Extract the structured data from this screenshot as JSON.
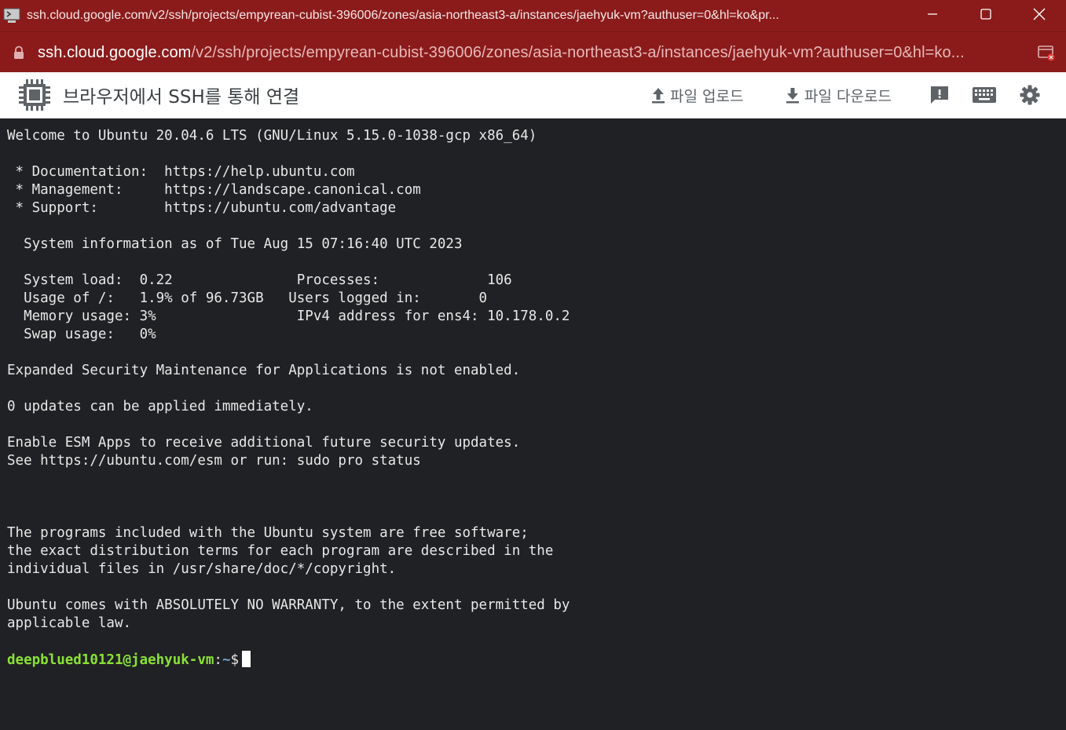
{
  "window": {
    "title": "ssh.cloud.google.com/v2/ssh/projects/empyrean-cubist-396006/zones/asia-northeast3-a/instances/jaehyuk-vm?authuser=0&hl=ko&pr...",
    "controls": [
      "minimize",
      "maximize",
      "close"
    ]
  },
  "address": {
    "host": "ssh.cloud.google.com",
    "path": "/v2/ssh/projects/empyrean-cubist-396006/zones/asia-northeast3-a/instances/jaehyuk-vm?authuser=0&hl=ko..."
  },
  "toolbar": {
    "heading": "브라우저에서 SSH를 통해 연결",
    "upload_label": "파일 업로드",
    "download_label": "파일 다운로드",
    "icons": [
      "feedback-icon",
      "keyboard-icon",
      "settings-icon"
    ]
  },
  "terminal": {
    "output": "Welcome to Ubuntu 20.04.6 LTS (GNU/Linux 5.15.0-1038-gcp x86_64)\n\n * Documentation:  https://help.ubuntu.com\n * Management:     https://landscape.canonical.com\n * Support:        https://ubuntu.com/advantage\n\n  System information as of Tue Aug 15 07:16:40 UTC 2023\n\n  System load:  0.22               Processes:             106\n  Usage of /:   1.9% of 96.73GB   Users logged in:       0\n  Memory usage: 3%                 IPv4 address for ens4: 10.178.0.2\n  Swap usage:   0%\n\nExpanded Security Maintenance for Applications is not enabled.\n\n0 updates can be applied immediately.\n\nEnable ESM Apps to receive additional future security updates.\nSee https://ubuntu.com/esm or run: sudo pro status\n\n\n\nThe programs included with the Ubuntu system are free software;\nthe exact distribution terms for each program are described in the\nindividual files in /usr/share/doc/*/copyright.\n\nUbuntu comes with ABSOLUTELY NO WARRANTY, to the extent permitted by\napplicable law.",
    "prompt_user": "deepblued10121@jaehyuk-vm",
    "prompt_sep": ":",
    "prompt_path": "~",
    "prompt_symbol": "$"
  },
  "colors": {
    "titlebar": "#8b1b1b",
    "terminal_bg": "#202124",
    "prompt_user": "#8ae234",
    "prompt_path": "#729fcf"
  }
}
